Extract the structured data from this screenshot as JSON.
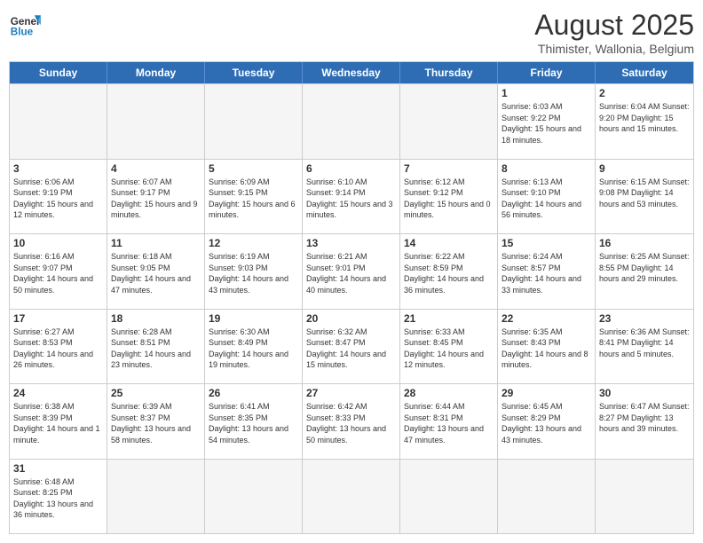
{
  "header": {
    "logo_general": "General",
    "logo_blue": "Blue",
    "month_year": "August 2025",
    "location": "Thimister, Wallonia, Belgium"
  },
  "weekdays": [
    "Sunday",
    "Monday",
    "Tuesday",
    "Wednesday",
    "Thursday",
    "Friday",
    "Saturday"
  ],
  "weeks": [
    [
      {
        "day": "",
        "info": "",
        "empty": true
      },
      {
        "day": "",
        "info": "",
        "empty": true
      },
      {
        "day": "",
        "info": "",
        "empty": true
      },
      {
        "day": "",
        "info": "",
        "empty": true
      },
      {
        "day": "",
        "info": "",
        "empty": true
      },
      {
        "day": "1",
        "info": "Sunrise: 6:03 AM\nSunset: 9:22 PM\nDaylight: 15 hours and 18 minutes."
      },
      {
        "day": "2",
        "info": "Sunrise: 6:04 AM\nSunset: 9:20 PM\nDaylight: 15 hours and 15 minutes."
      }
    ],
    [
      {
        "day": "3",
        "info": "Sunrise: 6:06 AM\nSunset: 9:19 PM\nDaylight: 15 hours and 12 minutes."
      },
      {
        "day": "4",
        "info": "Sunrise: 6:07 AM\nSunset: 9:17 PM\nDaylight: 15 hours and 9 minutes."
      },
      {
        "day": "5",
        "info": "Sunrise: 6:09 AM\nSunset: 9:15 PM\nDaylight: 15 hours and 6 minutes."
      },
      {
        "day": "6",
        "info": "Sunrise: 6:10 AM\nSunset: 9:14 PM\nDaylight: 15 hours and 3 minutes."
      },
      {
        "day": "7",
        "info": "Sunrise: 6:12 AM\nSunset: 9:12 PM\nDaylight: 15 hours and 0 minutes."
      },
      {
        "day": "8",
        "info": "Sunrise: 6:13 AM\nSunset: 9:10 PM\nDaylight: 14 hours and 56 minutes."
      },
      {
        "day": "9",
        "info": "Sunrise: 6:15 AM\nSunset: 9:08 PM\nDaylight: 14 hours and 53 minutes."
      }
    ],
    [
      {
        "day": "10",
        "info": "Sunrise: 6:16 AM\nSunset: 9:07 PM\nDaylight: 14 hours and 50 minutes."
      },
      {
        "day": "11",
        "info": "Sunrise: 6:18 AM\nSunset: 9:05 PM\nDaylight: 14 hours and 47 minutes."
      },
      {
        "day": "12",
        "info": "Sunrise: 6:19 AM\nSunset: 9:03 PM\nDaylight: 14 hours and 43 minutes."
      },
      {
        "day": "13",
        "info": "Sunrise: 6:21 AM\nSunset: 9:01 PM\nDaylight: 14 hours and 40 minutes."
      },
      {
        "day": "14",
        "info": "Sunrise: 6:22 AM\nSunset: 8:59 PM\nDaylight: 14 hours and 36 minutes."
      },
      {
        "day": "15",
        "info": "Sunrise: 6:24 AM\nSunset: 8:57 PM\nDaylight: 14 hours and 33 minutes."
      },
      {
        "day": "16",
        "info": "Sunrise: 6:25 AM\nSunset: 8:55 PM\nDaylight: 14 hours and 29 minutes."
      }
    ],
    [
      {
        "day": "17",
        "info": "Sunrise: 6:27 AM\nSunset: 8:53 PM\nDaylight: 14 hours and 26 minutes."
      },
      {
        "day": "18",
        "info": "Sunrise: 6:28 AM\nSunset: 8:51 PM\nDaylight: 14 hours and 23 minutes."
      },
      {
        "day": "19",
        "info": "Sunrise: 6:30 AM\nSunset: 8:49 PM\nDaylight: 14 hours and 19 minutes."
      },
      {
        "day": "20",
        "info": "Sunrise: 6:32 AM\nSunset: 8:47 PM\nDaylight: 14 hours and 15 minutes."
      },
      {
        "day": "21",
        "info": "Sunrise: 6:33 AM\nSunset: 8:45 PM\nDaylight: 14 hours and 12 minutes."
      },
      {
        "day": "22",
        "info": "Sunrise: 6:35 AM\nSunset: 8:43 PM\nDaylight: 14 hours and 8 minutes."
      },
      {
        "day": "23",
        "info": "Sunrise: 6:36 AM\nSunset: 8:41 PM\nDaylight: 14 hours and 5 minutes."
      }
    ],
    [
      {
        "day": "24",
        "info": "Sunrise: 6:38 AM\nSunset: 8:39 PM\nDaylight: 14 hours and 1 minute."
      },
      {
        "day": "25",
        "info": "Sunrise: 6:39 AM\nSunset: 8:37 PM\nDaylight: 13 hours and 58 minutes."
      },
      {
        "day": "26",
        "info": "Sunrise: 6:41 AM\nSunset: 8:35 PM\nDaylight: 13 hours and 54 minutes."
      },
      {
        "day": "27",
        "info": "Sunrise: 6:42 AM\nSunset: 8:33 PM\nDaylight: 13 hours and 50 minutes."
      },
      {
        "day": "28",
        "info": "Sunrise: 6:44 AM\nSunset: 8:31 PM\nDaylight: 13 hours and 47 minutes."
      },
      {
        "day": "29",
        "info": "Sunrise: 6:45 AM\nSunset: 8:29 PM\nDaylight: 13 hours and 43 minutes."
      },
      {
        "day": "30",
        "info": "Sunrise: 6:47 AM\nSunset: 8:27 PM\nDaylight: 13 hours and 39 minutes."
      }
    ],
    [
      {
        "day": "31",
        "info": "Sunrise: 6:48 AM\nSunset: 8:25 PM\nDaylight: 13 hours and 36 minutes."
      },
      {
        "day": "",
        "info": "",
        "empty": true
      },
      {
        "day": "",
        "info": "",
        "empty": true
      },
      {
        "day": "",
        "info": "",
        "empty": true
      },
      {
        "day": "",
        "info": "",
        "empty": true
      },
      {
        "day": "",
        "info": "",
        "empty": true
      },
      {
        "day": "",
        "info": "",
        "empty": true
      }
    ]
  ]
}
